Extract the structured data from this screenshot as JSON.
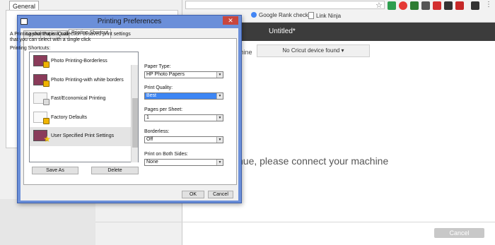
{
  "background": {
    "left_tab": "General",
    "bookmarks": [
      {
        "label": "Google Rank checker"
      },
      {
        "label": "Link Ninja"
      }
    ],
    "app_title": "Untitled*",
    "machine_label": "chine",
    "device_button": "No Cricut device found ▾",
    "connect_message": "nue, please connect your machine",
    "cancel_button": "Cancel"
  },
  "colors": {
    "dialog_frame": "#6b8fd9",
    "selection": "#3d86f4",
    "app_header": "#3c3c3c"
  },
  "dialog": {
    "title": "Printing Preferences",
    "close": "✕",
    "tabs": [
      "Layout",
      "Paper/Quality",
      "Printing Shortcut"
    ],
    "active_tab": "Printing Shortcut",
    "description": "A Printing shortcut is a collection of saved print settings that you can select with a single click",
    "shortcuts_label": "Printing Shortcuts:",
    "shortcuts": [
      {
        "name": "Photo Printing-Borderless",
        "icon": "photo-lock-icon"
      },
      {
        "name": "Photo Printing-with white borders",
        "icon": "photo-lock-icon"
      },
      {
        "name": "Fast/Economical Printing",
        "icon": "document-lock-icon"
      },
      {
        "name": "Factory Defaults",
        "icon": "document-lock-icon"
      },
      {
        "name": "User Specified Print Settings",
        "icon": "photo-star-icon",
        "selected": true
      }
    ],
    "save_as": "Save As",
    "delete": "Delete",
    "fields": [
      {
        "label": "Paper Type:",
        "value": "HP Photo Papers"
      },
      {
        "label": "Print Quality:",
        "value": "Best",
        "highlighted": true
      },
      {
        "label": "Pages per Sheet:",
        "value": "1"
      },
      {
        "label": "Borderless:",
        "value": "Off"
      },
      {
        "label": "Print on Both Sides:",
        "value": "None"
      }
    ],
    "ok": "OK",
    "cancel": "Cancel"
  }
}
